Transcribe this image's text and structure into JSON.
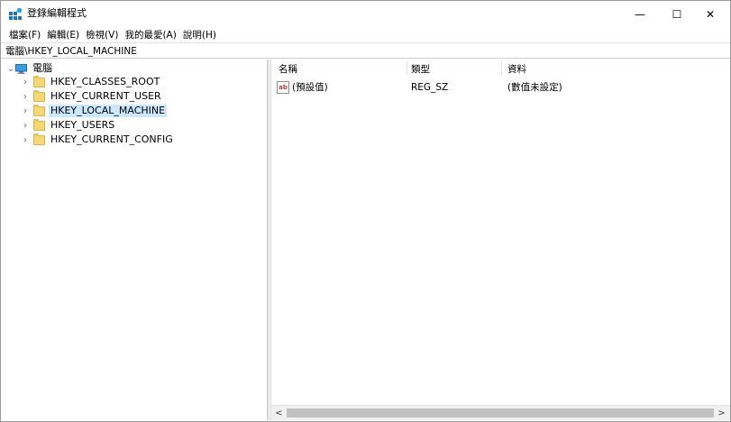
{
  "window": {
    "title": "登錄編輯程式",
    "controls": {
      "minimize": "—",
      "maximize": "☐",
      "close": "✕"
    }
  },
  "menu": [
    {
      "label": "檔案(F)"
    },
    {
      "label": "編輯(E)"
    },
    {
      "label": "檢視(V)"
    },
    {
      "label": "我的最愛(A)"
    },
    {
      "label": "說明(H)"
    }
  ],
  "address": {
    "path": "電腦\\HKEY_LOCAL_MACHINE"
  },
  "tree": {
    "root": {
      "label": "電腦",
      "expanded": true
    },
    "items": [
      {
        "label": "HKEY_CLASSES_ROOT",
        "selected": false
      },
      {
        "label": "HKEY_CURRENT_USER",
        "selected": false
      },
      {
        "label": "HKEY_LOCAL_MACHINE",
        "selected": true
      },
      {
        "label": "HKEY_USERS",
        "selected": false
      },
      {
        "label": "HKEY_CURRENT_CONFIG",
        "selected": false
      }
    ]
  },
  "list": {
    "columns": {
      "name": "名稱",
      "type": "類型",
      "data": "資料"
    },
    "rows": [
      {
        "name": "(預設值)",
        "type": "REG_SZ",
        "data": "(數值未設定)",
        "icon": "string-value-icon"
      }
    ]
  },
  "scrollbar": {
    "left_arrow": "<",
    "right_arrow": ">"
  }
}
